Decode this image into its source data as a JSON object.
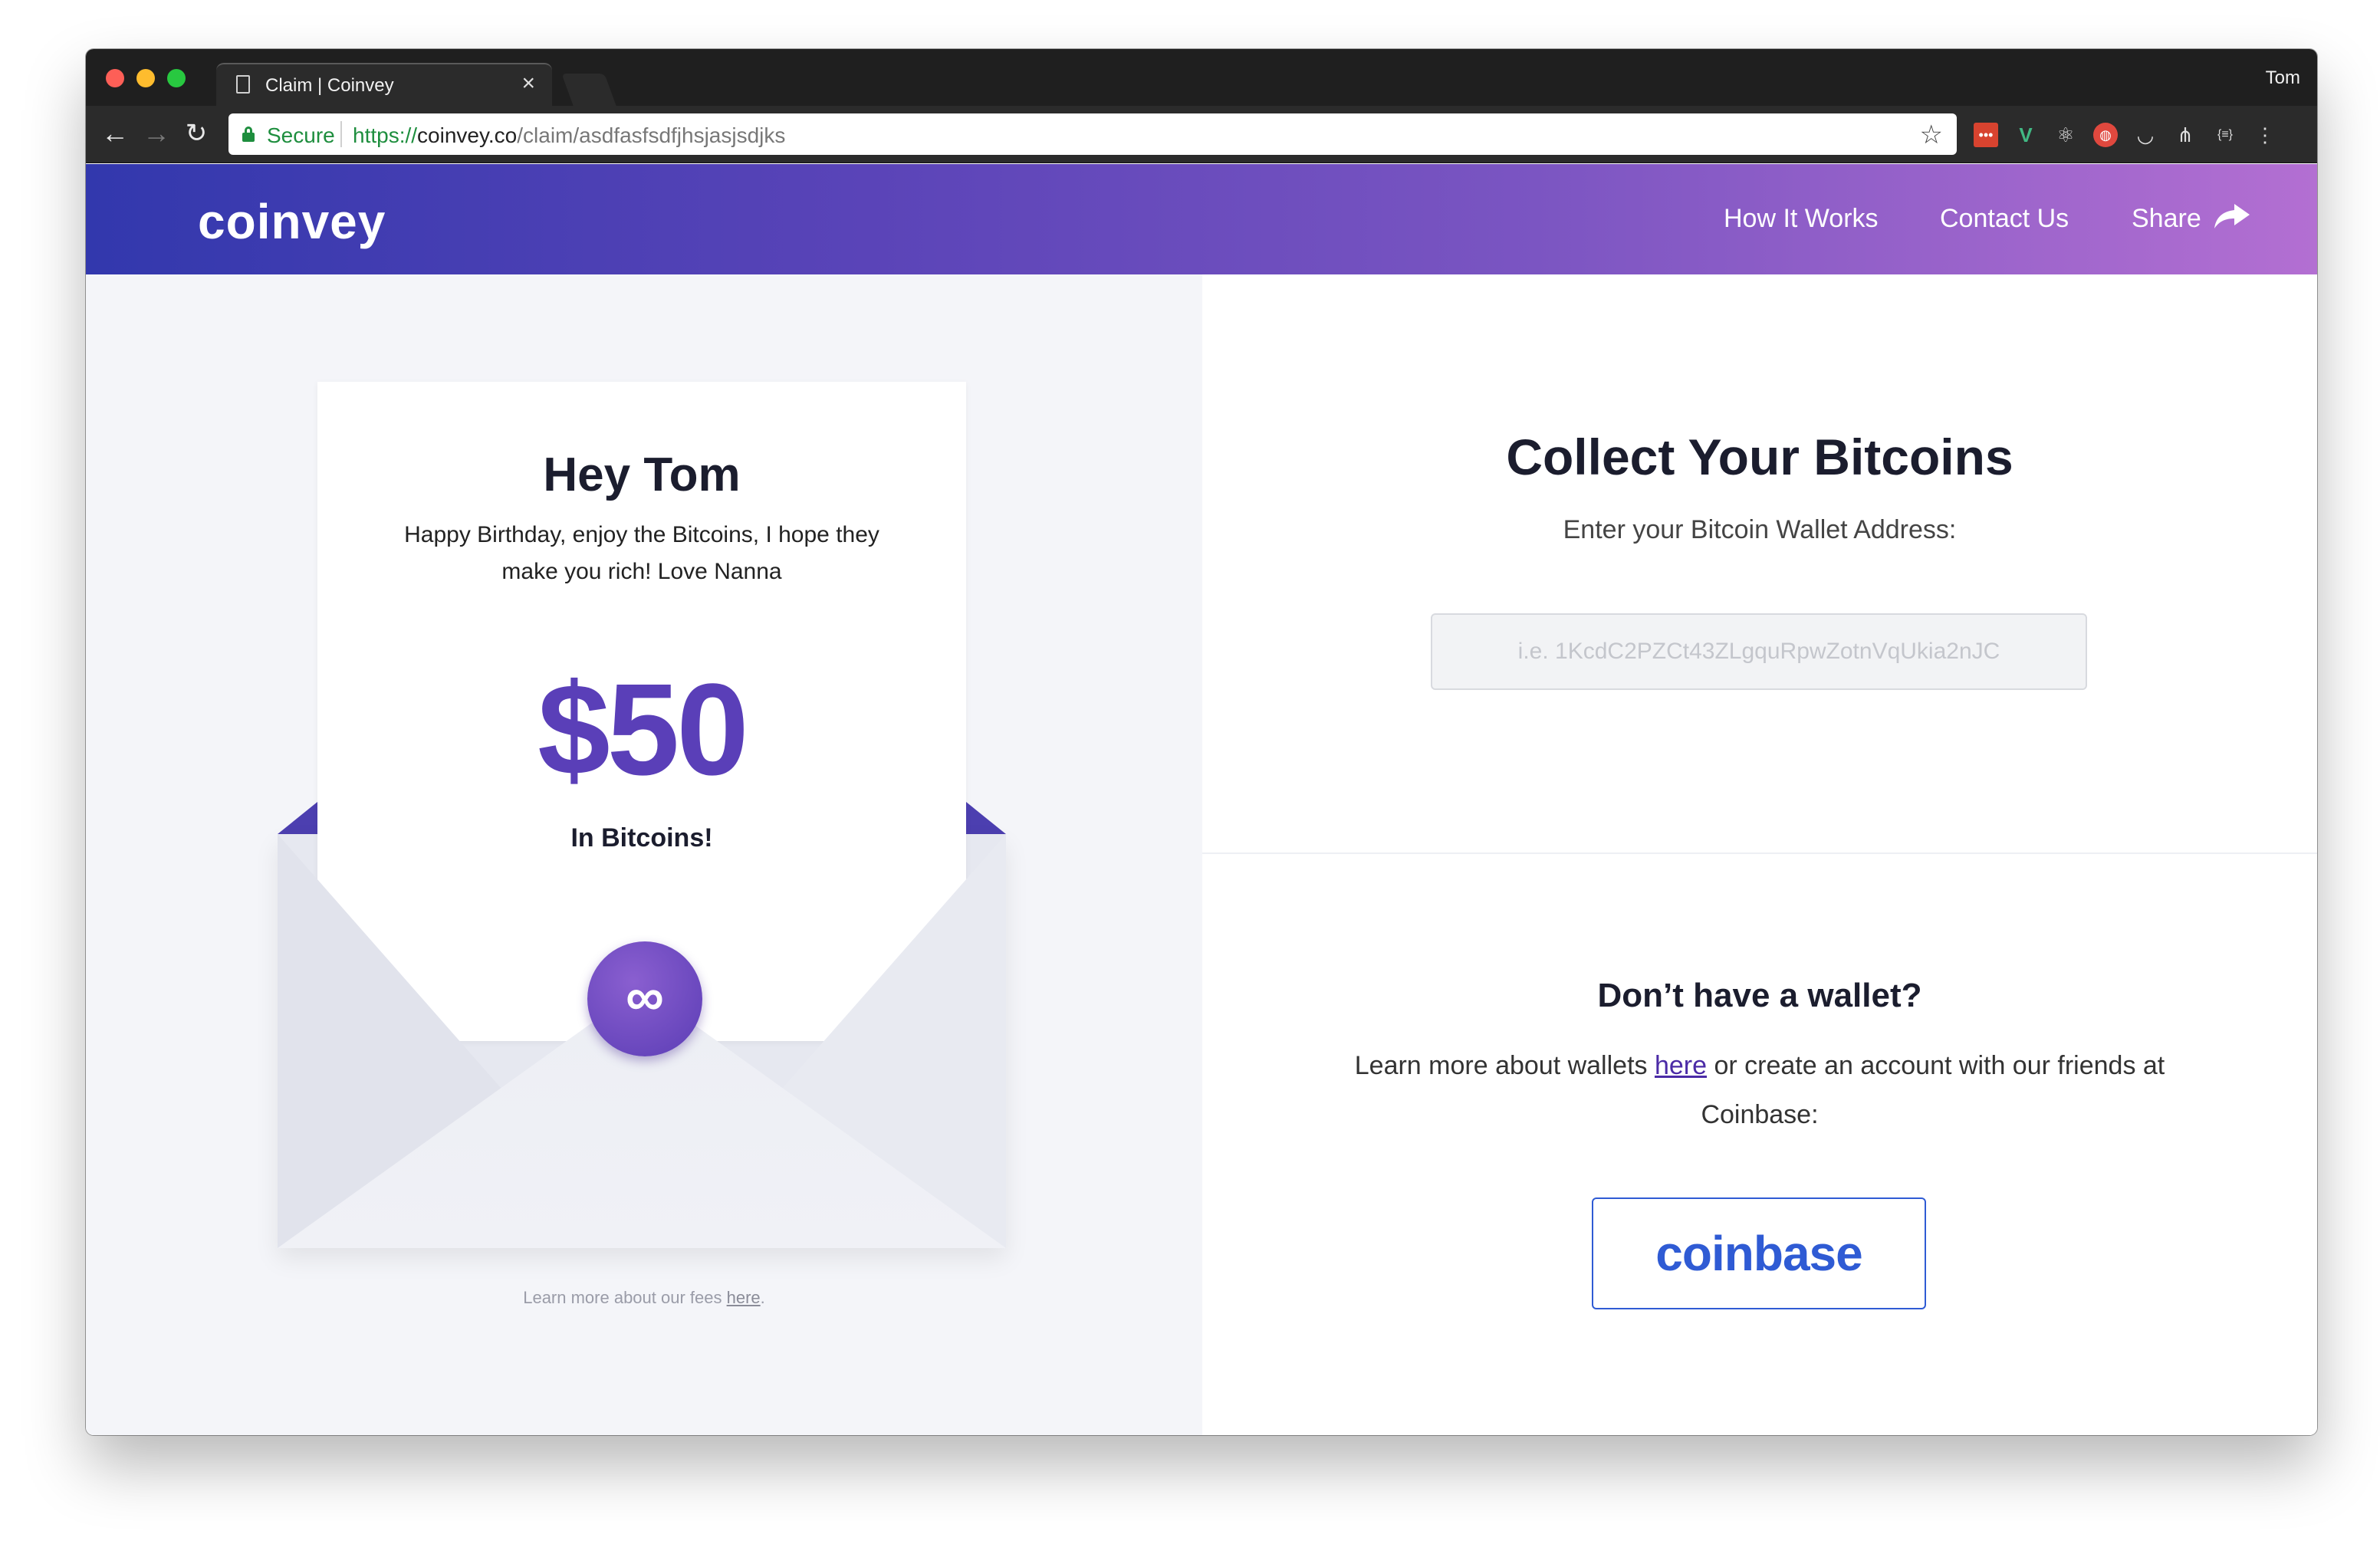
{
  "browser": {
    "tab_title": "Claim | Coinvey",
    "tab_close": "×",
    "profile": "Tom",
    "secure_label": "Secure",
    "url_scheme": "https://",
    "url_host": "coinvey.co",
    "url_path": "/claim/asdfasfsdfjhsjasjsdjks",
    "icons": [
      "back-icon",
      "forward-icon",
      "reload-icon",
      "lock-icon",
      "star-icon",
      "lastpass-icon",
      "vue-devtools-icon",
      "react-devtools-icon",
      "ublock-icon",
      "pocket-icon",
      "network-icon",
      "json-icon",
      "menu-icon"
    ]
  },
  "header": {
    "logo": "coinvey",
    "nav": {
      "how": "How It Works",
      "contact": "Contact Us",
      "share": "Share"
    }
  },
  "card": {
    "greeting": "Hey Tom",
    "message": "Happy Birthday, enjoy the Bitcoins, I hope they make you rich! Love Nanna",
    "amount": "$50",
    "sub": "In Bitcoins!",
    "seal_glyph": "∞"
  },
  "fees": {
    "prefix": "Learn more about our fees ",
    "link": "here",
    "suffix": "."
  },
  "collect": {
    "title": "Collect Your Bitcoins",
    "subtitle": "Enter your Bitcoin Wallet Address:",
    "input_placeholder": "i.e. 1KcdC2PZCt43ZLgquRpwZotnVqUkia2nJC",
    "input_value": ""
  },
  "nowallet": {
    "title": "Don’t have a wallet?",
    "text_prefix": "Learn more about wallets ",
    "link": "here",
    "text_suffix": " or create an account with our friends at Coinbase:",
    "coinbase_label": "coinbase"
  },
  "colors": {
    "brand_purple": "#5a3fb8",
    "header_gradient_start": "#3238ad",
    "header_gradient_end": "#b36fd2",
    "coinbase_blue": "#2f5bd4",
    "secure_green": "#1e8e3e"
  }
}
